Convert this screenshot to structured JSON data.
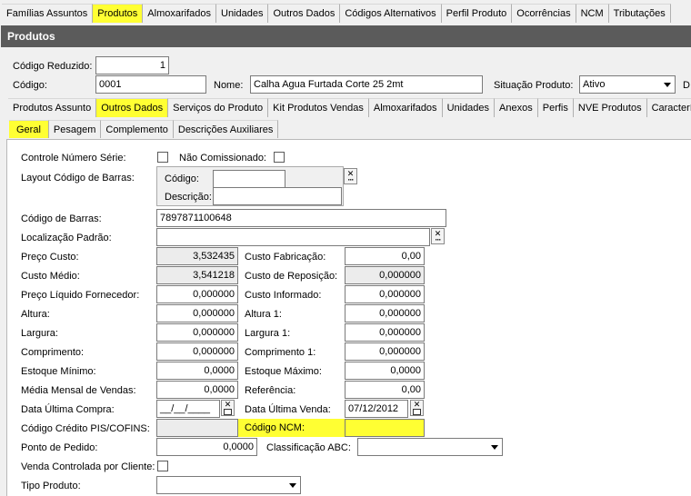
{
  "top_tabs": [
    "Famílias Assuntos",
    "Produtos",
    "Almoxarifados",
    "Unidades",
    "Outros Dados",
    "Códigos Alternativos",
    "Perfil Produto",
    "Ocorrências",
    "NCM",
    "Tributações"
  ],
  "header": {
    "title": "Produtos"
  },
  "codigo_reduzido": {
    "label": "Código Reduzido:",
    "value": "1"
  },
  "codigo": {
    "label": "Código:",
    "value": "0001"
  },
  "nome": {
    "label": "Nome:",
    "value": "Calha Agua Furtada Corte 25  2mt"
  },
  "situacao": {
    "label": "Situação Produto:",
    "value": "Ativo",
    "next_label": "D"
  },
  "sub_tabs": [
    "Produtos Assunto",
    "Outros Dados",
    "Serviços do Produto",
    "Kit Produtos Vendas",
    "Almoxarifados",
    "Unidades",
    "Anexos",
    "Perfis",
    "NVE Produtos",
    "Característic"
  ],
  "inner_tabs": [
    "Geral",
    "Pesagem",
    "Complemento",
    "Descrições Auxiliares"
  ],
  "form": {
    "controle_numero_serie": "Controle Número Série:",
    "nao_comissionado": "Não Comissionado:",
    "layout_codigo_barras": "Layout Código de Barras:",
    "layout_codigo": "Código:",
    "layout_descricao": "Descrição:",
    "codigo_barras": {
      "label": "Código de Barras:",
      "value": "7897871100648"
    },
    "localizacao_padrao": {
      "label": "Localização Padrão:",
      "value": ""
    },
    "preco_custo": {
      "label": "Preço Custo:",
      "value": "3,532435"
    },
    "custo_fabricacao": {
      "label": "Custo Fabricação:",
      "value": "0,00"
    },
    "custo_medio": {
      "label": "Custo Médio:",
      "value": "3,541218"
    },
    "custo_reposicao": {
      "label": "Custo de Reposição:",
      "value": "0,000000"
    },
    "preco_liquido_fornecedor": {
      "label": "Preço Líquido Fornecedor:",
      "value": "0,000000"
    },
    "custo_informado": {
      "label": "Custo Informado:",
      "value": "0,000000"
    },
    "altura": {
      "label": "Altura:",
      "value": "0,000000"
    },
    "altura1": {
      "label": "Altura 1:",
      "value": "0,000000"
    },
    "largura": {
      "label": "Largura:",
      "value": "0,000000"
    },
    "largura1": {
      "label": "Largura 1:",
      "value": "0,000000"
    },
    "comprimento": {
      "label": "Comprimento:",
      "value": "0,000000"
    },
    "comprimento1": {
      "label": "Comprimento 1:",
      "value": "0,000000"
    },
    "estoque_minimo": {
      "label": "Estoque Mínimo:",
      "value": "0,0000"
    },
    "estoque_maximo": {
      "label": "Estoque Máximo:",
      "value": "0,0000"
    },
    "media_mensal_vendas": {
      "label": "Média Mensal de Vendas:",
      "value": "0,0000"
    },
    "referencia": {
      "label": "Referência:",
      "value": "0,00"
    },
    "data_ultima_compra": {
      "label": "Data Última Compra:",
      "value": "__/__/____"
    },
    "data_ultima_venda": {
      "label": "Data Última Venda:",
      "value": "07/12/2012"
    },
    "codigo_credito_pis": {
      "label": "Código Crédito PIS/COFINS:",
      "value": ""
    },
    "codigo_ncm": {
      "label": "Código NCM:",
      "value": ""
    },
    "ponto_pedido": {
      "label": "Ponto de Pedido:",
      "value": "0,0000"
    },
    "classificacao_abc": {
      "label": "Classificação ABC:",
      "value": ""
    },
    "venda_controlada": "Venda Controlada por Cliente:",
    "tipo_produto": {
      "label": "Tipo Produto:",
      "value": ""
    }
  },
  "colors": {
    "highlight": "#ffff33",
    "header_bg": "#5b5b5b"
  }
}
